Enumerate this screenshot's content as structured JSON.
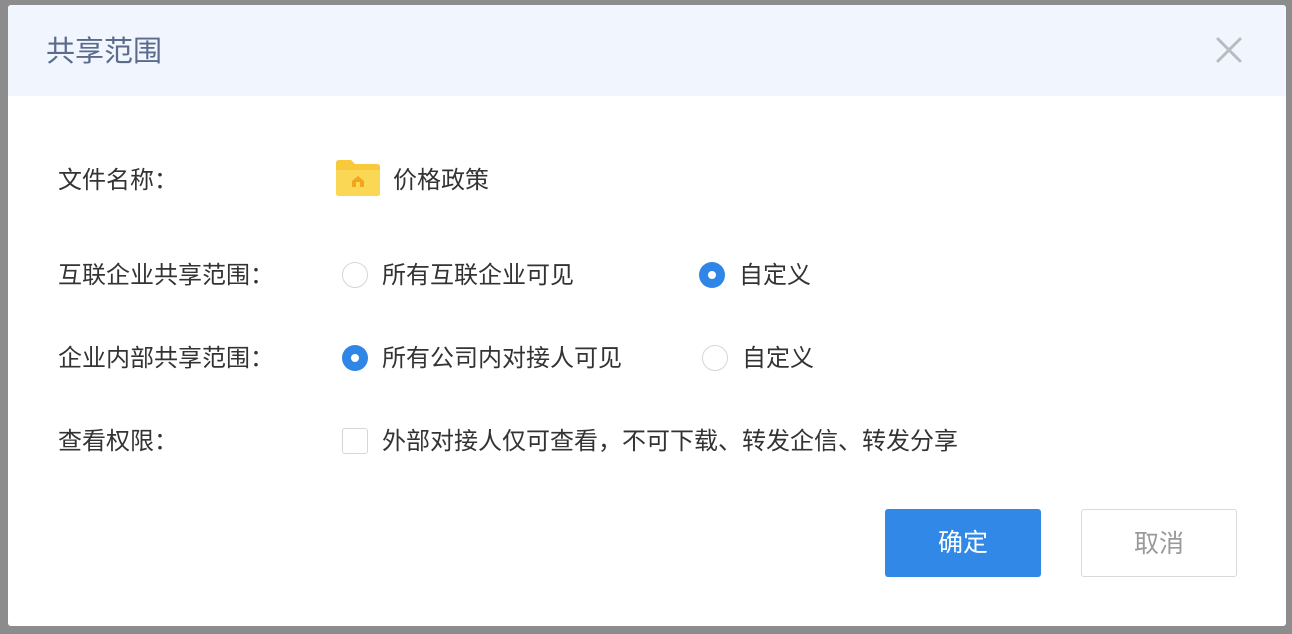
{
  "dialog": {
    "title": "共享范围",
    "close_icon": "close-icon"
  },
  "file_row": {
    "label": "文件名称：",
    "icon": "folder-icon",
    "folder_color": "#f8c93b",
    "name": "价格政策"
  },
  "interconnect_row": {
    "label": "互联企业共享范围：",
    "options": [
      {
        "label": "所有互联企业可见",
        "checked": false
      },
      {
        "label": "自定义",
        "checked": true
      }
    ]
  },
  "internal_row": {
    "label": "企业内部共享范围：",
    "options": [
      {
        "label": "所有公司内对接人可见",
        "checked": true
      },
      {
        "label": "自定义",
        "checked": false
      }
    ]
  },
  "permission_row": {
    "label": "查看权限：",
    "checkbox_label": "外部对接人仅可查看，不可下载、转发企信、转发分享",
    "checked": false
  },
  "buttons": {
    "confirm": "确定",
    "cancel": "取消"
  },
  "colors": {
    "accent": "#3188e6",
    "header_bg": "#f1f5fd"
  }
}
